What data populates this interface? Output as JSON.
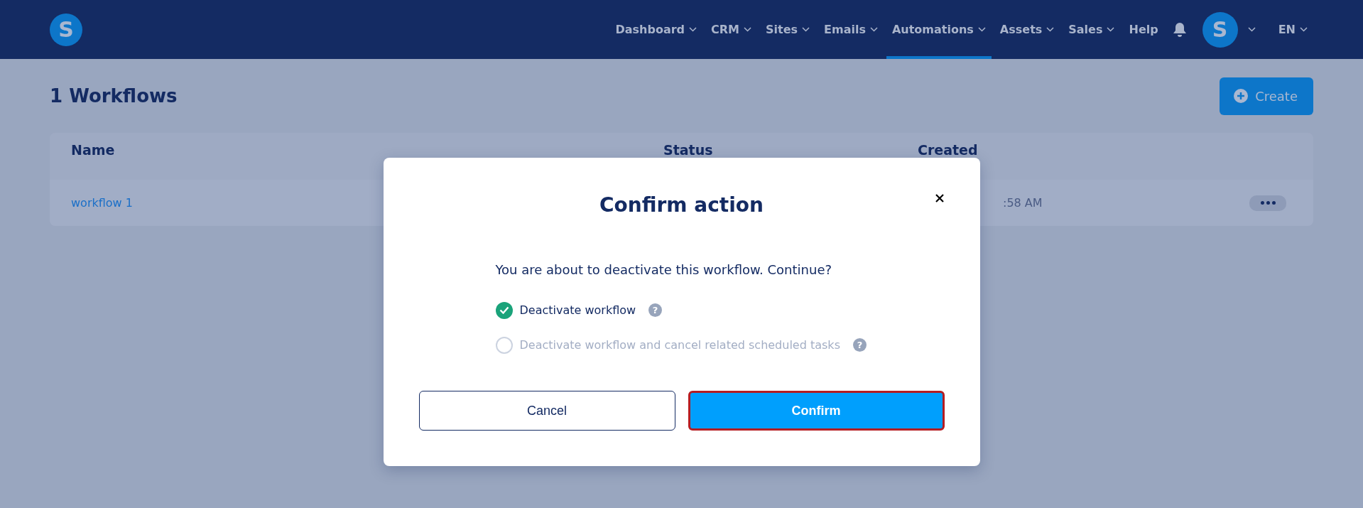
{
  "header": {
    "logo": "S",
    "nav": [
      {
        "label": "Dashboard",
        "selected": false,
        "dropdown": true
      },
      {
        "label": "CRM",
        "selected": false,
        "dropdown": true
      },
      {
        "label": "Sites",
        "selected": false,
        "dropdown": true
      },
      {
        "label": "Emails",
        "selected": false,
        "dropdown": true
      },
      {
        "label": "Automations",
        "selected": true,
        "dropdown": true
      },
      {
        "label": "Assets",
        "selected": false,
        "dropdown": true
      },
      {
        "label": "Sales",
        "selected": false,
        "dropdown": true
      },
      {
        "label": "Help",
        "selected": false,
        "dropdown": false
      }
    ],
    "avatar": "S",
    "language": "EN"
  },
  "page": {
    "title": "1 Workflows",
    "create_button": "Create"
  },
  "table": {
    "columns": [
      "Name",
      "Status",
      "Created"
    ],
    "rows": [
      {
        "name": "workflow 1",
        "created": ":58 AM"
      }
    ]
  },
  "dialog": {
    "title": "Confirm action",
    "message": "You are about to deactivate this workflow. Continue?",
    "options": [
      {
        "label": "Deactivate workflow",
        "selected": true,
        "help": "?"
      },
      {
        "label": "Deactivate workflow and cancel related scheduled tasks",
        "selected": false,
        "help": "?"
      }
    ],
    "buttons": [
      {
        "label": "Cancel",
        "kind": "secondary"
      },
      {
        "label": "Confirm",
        "kind": "primary"
      }
    ]
  }
}
